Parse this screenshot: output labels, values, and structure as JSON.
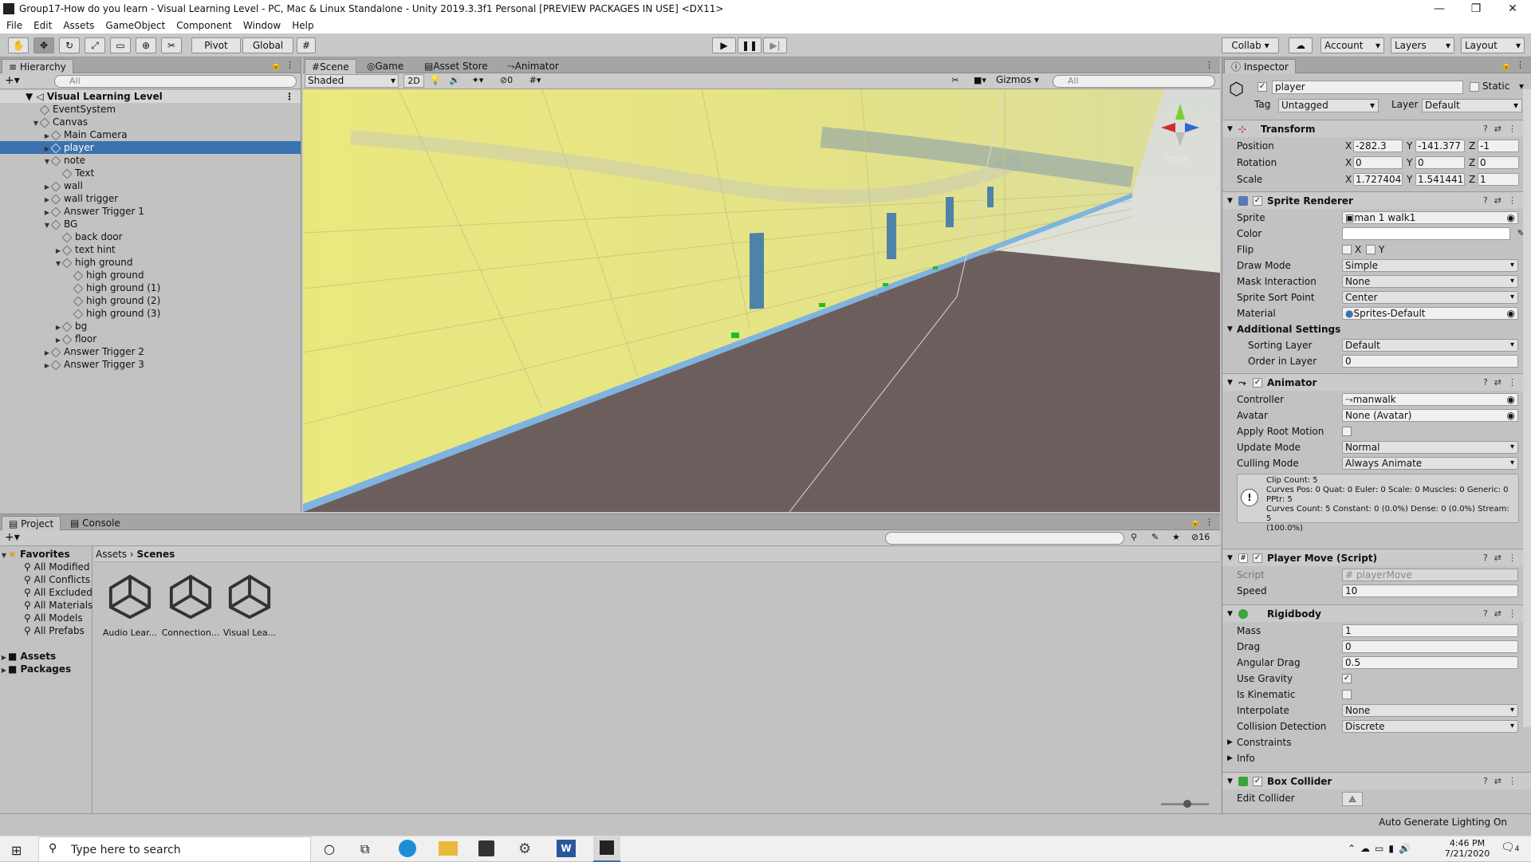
{
  "window": {
    "title": "Group17-How do you learn - Visual Learning Level - PC, Mac & Linux Standalone - Unity 2019.3.3f1 Personal [PREVIEW PACKAGES IN USE] <DX11>",
    "minimize": "—",
    "maximize": "❐",
    "close": "✕"
  },
  "menu": [
    "File",
    "Edit",
    "Assets",
    "GameObject",
    "Component",
    "Window",
    "Help"
  ],
  "toolbar": {
    "pivot": "Pivot",
    "global": "Global",
    "collab": "Collab ▾",
    "account": "Account",
    "layers": "Layers",
    "layout": "Layout"
  },
  "hierarchy": {
    "tab": "Hierarchy",
    "search_placeholder": "All",
    "scene": "Visual Learning Level",
    "items": [
      {
        "label": "EventSystem",
        "depth": 1,
        "arrow": ""
      },
      {
        "label": "Canvas",
        "depth": 1,
        "arrow": "▼"
      },
      {
        "label": "Main Camera",
        "depth": 2,
        "arrow": "▶"
      },
      {
        "label": "player",
        "depth": 2,
        "arrow": "▶",
        "selected": true
      },
      {
        "label": "note",
        "depth": 2,
        "arrow": "▼"
      },
      {
        "label": "Text",
        "depth": 3,
        "arrow": ""
      },
      {
        "label": "wall",
        "depth": 2,
        "arrow": "▶"
      },
      {
        "label": "wall trigger",
        "depth": 2,
        "arrow": "▶"
      },
      {
        "label": "Answer Trigger 1",
        "depth": 2,
        "arrow": "▶"
      },
      {
        "label": "BG",
        "depth": 2,
        "arrow": "▼"
      },
      {
        "label": "back door",
        "depth": 3,
        "arrow": ""
      },
      {
        "label": "text hint",
        "depth": 3,
        "arrow": "▶"
      },
      {
        "label": "high ground",
        "depth": 3,
        "arrow": "▼"
      },
      {
        "label": "high ground",
        "depth": 4,
        "arrow": ""
      },
      {
        "label": "high ground (1)",
        "depth": 4,
        "arrow": ""
      },
      {
        "label": "high ground (2)",
        "depth": 4,
        "arrow": ""
      },
      {
        "label": "high ground (3)",
        "depth": 4,
        "arrow": ""
      },
      {
        "label": "bg",
        "depth": 3,
        "arrow": "▶"
      },
      {
        "label": "floor",
        "depth": 3,
        "arrow": "▶"
      },
      {
        "label": "Answer Trigger 2",
        "depth": 2,
        "arrow": "▶"
      },
      {
        "label": "Answer Trigger 3",
        "depth": 2,
        "arrow": "▶"
      }
    ]
  },
  "scene": {
    "tabs": [
      "Scene",
      "Game",
      "Asset Store",
      "Animator"
    ],
    "shading": "Shaded",
    "mode2d": "2D",
    "hidden_count": "0",
    "gizmos": "Gizmos",
    "search_placeholder": "All",
    "persp": "Persp"
  },
  "project": {
    "tabs": [
      "Project",
      "Console"
    ],
    "favorites_label": "Favorites",
    "favorites": [
      "All Modified",
      "All Conflicts",
      "All Excluded",
      "All Materials",
      "All Models",
      "All Prefabs"
    ],
    "roots": [
      "Assets",
      "Packages"
    ],
    "breadcrumb": [
      "Assets",
      "Scenes"
    ],
    "files": [
      "Audio Lear...",
      "Connection...",
      "Visual Lea..."
    ],
    "hidden_count": "16"
  },
  "inspector": {
    "tab": "Inspector",
    "object_name": "player",
    "static_label": "Static",
    "tag_label": "Tag",
    "tag": "Untagged",
    "layer_label": "Layer",
    "layer": "Default",
    "transform": {
      "title": "Transform",
      "position": {
        "label": "Position",
        "x": "-282.3",
        "y": "-141.377",
        "z": "-1"
      },
      "rotation": {
        "label": "Rotation",
        "x": "0",
        "y": "0",
        "z": "0"
      },
      "scale": {
        "label": "Scale",
        "x": "1.727404",
        "y": "1.541441",
        "z": "1"
      }
    },
    "sprite_renderer": {
      "title": "Sprite Renderer",
      "sprite_label": "Sprite",
      "sprite": "man 1 walk1",
      "color_label": "Color",
      "flip_label": "Flip",
      "flip_x": "X",
      "flip_y": "Y",
      "draw_mode_label": "Draw Mode",
      "draw_mode": "Simple",
      "mask_label": "Mask Interaction",
      "mask": "None",
      "sort_point_label": "Sprite Sort Point",
      "sort_point": "Center",
      "material_label": "Material",
      "material": "Sprites-Default",
      "additional": "Additional Settings",
      "sorting_layer_label": "Sorting Layer",
      "sorting_layer": "Default",
      "order_label": "Order in Layer",
      "order": "0"
    },
    "animator": {
      "title": "Animator",
      "controller_label": "Controller",
      "controller": "manwalk",
      "avatar_label": "Avatar",
      "avatar": "None (Avatar)",
      "root_motion_label": "Apply Root Motion",
      "update_label": "Update Mode",
      "update": "Normal",
      "culling_label": "Culling Mode",
      "culling": "Always Animate",
      "info": [
        "Clip Count: 5",
        "Curves Pos: 0 Quat: 0 Euler: 0 Scale: 0 Muscles: 0 Generic: 0",
        "PPtr: 5",
        "Curves Count: 5 Constant: 0 (0.0%) Dense: 0 (0.0%) Stream: 5",
        "(100.0%)"
      ]
    },
    "player_move": {
      "title": "Player Move (Script)",
      "script_label": "Script",
      "script": "playerMove",
      "speed_label": "Speed",
      "speed": "10"
    },
    "rigidbody": {
      "title": "Rigidbody",
      "mass_label": "Mass",
      "mass": "1",
      "drag_label": "Drag",
      "drag": "0",
      "angular_label": "Angular Drag",
      "angular": "0.5",
      "gravity_label": "Use Gravity",
      "kinematic_label": "Is Kinematic",
      "interpolate_label": "Interpolate",
      "interpolate": "None",
      "collision_label": "Collision Detection",
      "collision": "Discrete",
      "constraints": "Constraints",
      "info": "Info"
    },
    "box_collider": {
      "title": "Box Collider",
      "edit_label": "Edit Collider"
    }
  },
  "status": {
    "right": "Auto Generate Lighting On"
  },
  "taskbar": {
    "search_placeholder": "Type here to search",
    "time": "4:46 PM",
    "date": "7/21/2020",
    "notifications": "4"
  }
}
